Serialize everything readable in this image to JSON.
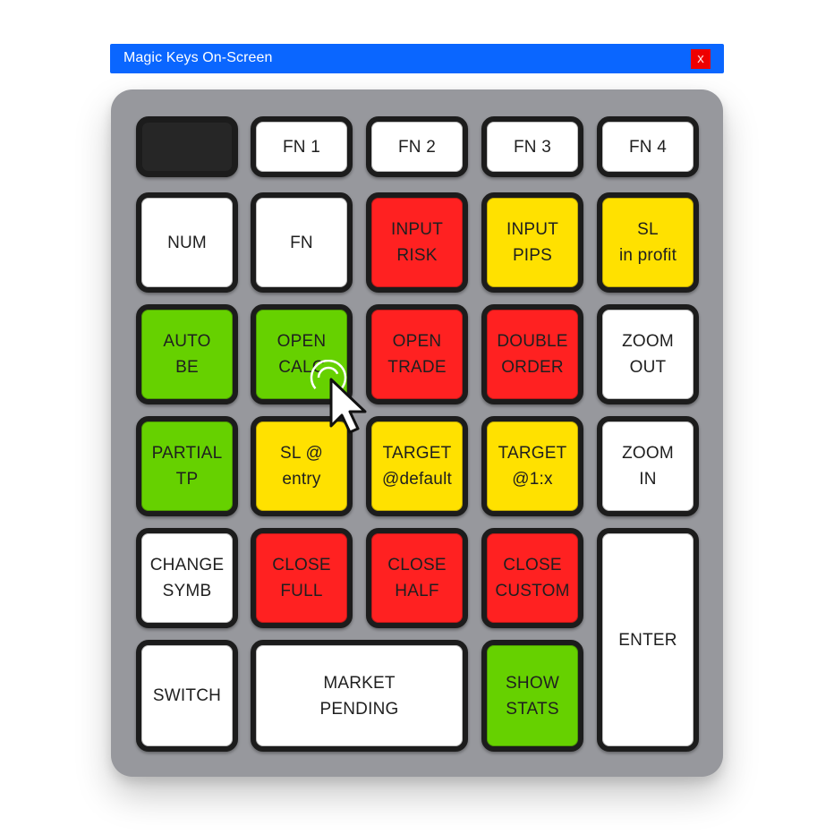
{
  "window": {
    "title": "Magic Keys On-Screen",
    "close_label": "x",
    "accent_color": "#0a66ff",
    "close_color": "#ee0000"
  },
  "colors": {
    "white": "#ffffff",
    "red": "#ff2121",
    "yellow": "#ffe100",
    "green": "#66d100",
    "black": "#262626",
    "panel": "#97989d"
  },
  "keys": [
    {
      "id": "blank",
      "label": "",
      "color": "black"
    },
    {
      "id": "fn1",
      "label": "FN 1",
      "color": "white"
    },
    {
      "id": "fn2",
      "label": "FN 2",
      "color": "white"
    },
    {
      "id": "fn3",
      "label": "FN 3",
      "color": "white"
    },
    {
      "id": "fn4",
      "label": "FN 4",
      "color": "white"
    },
    {
      "id": "num",
      "label": "NUM",
      "color": "white"
    },
    {
      "id": "fn",
      "label": "FN",
      "color": "white"
    },
    {
      "id": "input-risk",
      "label": "INPUT\nRISK",
      "color": "red"
    },
    {
      "id": "input-pips",
      "label": "INPUT\nPIPS",
      "color": "yellow"
    },
    {
      "id": "sl-in-profit",
      "label": "SL\nin profit",
      "color": "yellow"
    },
    {
      "id": "auto-be",
      "label": "AUTO\nBE",
      "color": "green"
    },
    {
      "id": "open-calc",
      "label": "OPEN\nCALC",
      "color": "green"
    },
    {
      "id": "open-trade",
      "label": "OPEN\nTRADE",
      "color": "red"
    },
    {
      "id": "double-order",
      "label": "DOUBLE\nORDER",
      "color": "red"
    },
    {
      "id": "zoom-out",
      "label": "ZOOM\nOUT",
      "color": "white"
    },
    {
      "id": "partial-tp",
      "label": "PARTIAL\nTP",
      "color": "green"
    },
    {
      "id": "sl-at-entry",
      "label": "SL @\nentry",
      "color": "yellow"
    },
    {
      "id": "target-default",
      "label": "TARGET\n@default",
      "color": "yellow"
    },
    {
      "id": "target-1x",
      "label": "TARGET\n@1:x",
      "color": "yellow"
    },
    {
      "id": "zoom-in",
      "label": "ZOOM\nIN",
      "color": "white"
    },
    {
      "id": "change-symb",
      "label": "CHANGE\nSYMB",
      "color": "white"
    },
    {
      "id": "close-full",
      "label": "CLOSE\nFULL",
      "color": "red"
    },
    {
      "id": "close-half",
      "label": "CLOSE\nHALF",
      "color": "red"
    },
    {
      "id": "close-custom",
      "label": "CLOSE\nCUSTOM",
      "color": "red"
    },
    {
      "id": "enter",
      "label": "ENTER",
      "color": "white"
    },
    {
      "id": "switch",
      "label": "SWITCH",
      "color": "white"
    },
    {
      "id": "market-pending",
      "label": "MARKET\nPENDING",
      "color": "white"
    },
    {
      "id": "show-stats",
      "label": "SHOW\nSTATS",
      "color": "green"
    }
  ]
}
